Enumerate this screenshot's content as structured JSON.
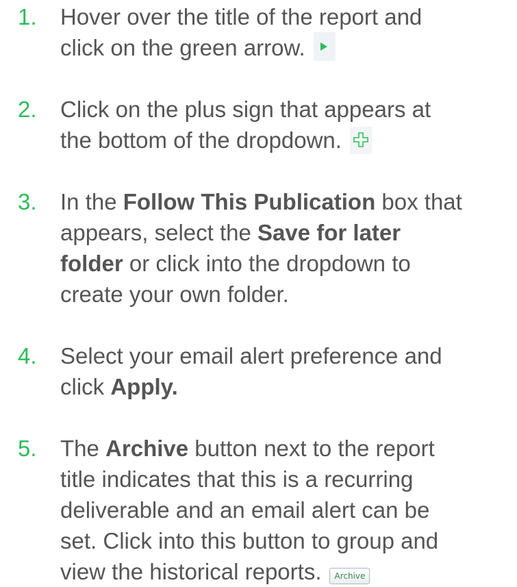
{
  "steps": [
    {
      "number": "1.",
      "lines": [
        "Hover over the title of the report and",
        "click on the green arrow."
      ],
      "icon": "green-arrow-icon"
    },
    {
      "number": "2.",
      "lines": [
        "Click on the plus sign that appears at",
        "the bottom of the dropdown."
      ],
      "icon": "green-plus-icon"
    },
    {
      "number": "3.",
      "parts": {
        "a": "In the ",
        "b": "Follow This Publication",
        "c": " box that",
        "d": "appears, select the ",
        "e": "Save for later",
        "f": "folder",
        "g": " or click into the dropdown to",
        "h": "create your own folder."
      }
    },
    {
      "number": "4.",
      "parts": {
        "a": "Select your email alert preference and",
        "b": "click ",
        "c": "Apply."
      }
    },
    {
      "number": "5.",
      "parts": {
        "a": "The ",
        "b": "Archive",
        "c": " button next to the report",
        "d": "title indicates that this is a recurring",
        "e": "deliverable and an email alert can be",
        "f": "set. Click into this button to group and",
        "g": "view the historical reports."
      },
      "button_label": "Archive"
    }
  ],
  "colors": {
    "number": "#2dbd59",
    "text": "#555555",
    "icon_green": "#2dbd59"
  }
}
